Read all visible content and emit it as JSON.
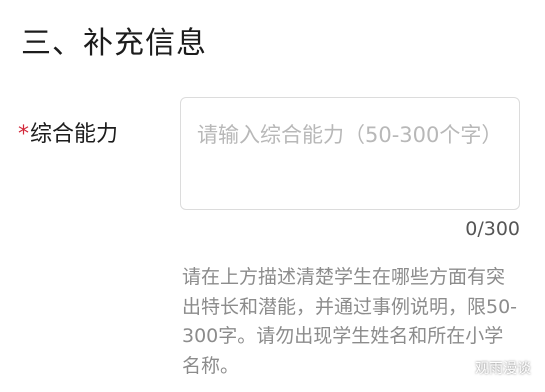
{
  "section": {
    "title": "三、补充信息"
  },
  "field": {
    "required_mark": "*",
    "label": "综合能力",
    "placeholder": "请输入综合能力（50-300个字）",
    "value": "",
    "char_count": "0/300",
    "hint": "请在上方描述清楚学生在哪些方面有突出特长和潜能，并通过事例说明，限50-300字。请勿出现学生姓名和所在小学名称。"
  },
  "watermark": {
    "icon": "wechat-icon",
    "text": "观雨漫谈"
  },
  "colors": {
    "required": "#d2283a",
    "placeholder": "#b8b8b8",
    "hint": "#8c8c8c",
    "border": "#dcdcdc"
  }
}
